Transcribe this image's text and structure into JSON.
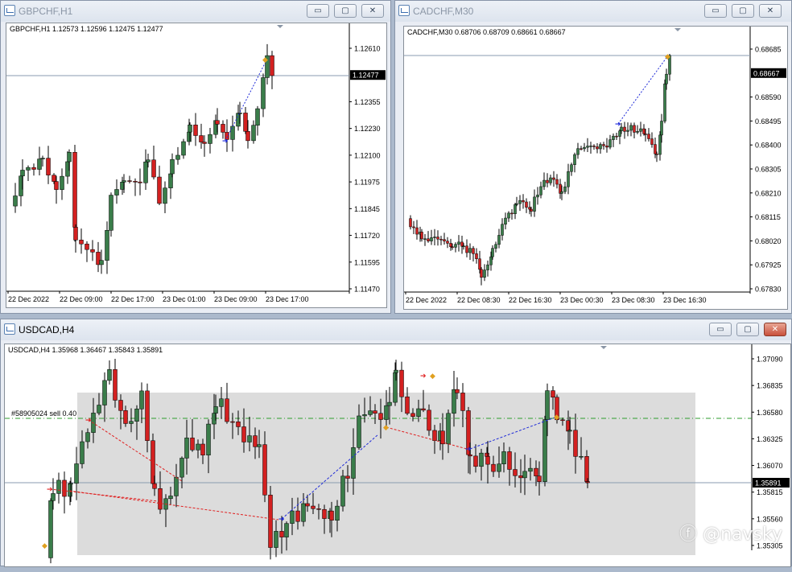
{
  "windows": [
    {
      "id": "gbp",
      "title": "GBPCHF,H1",
      "info": "GBPCHF,H1  1.12573 1.12596 1.12475 1.12477",
      "price_labels": [
        "1.12610",
        "1.12477",
        "1.12355",
        "1.12230",
        "1.12100",
        "1.11975",
        "1.11845",
        "1.11720",
        "1.11595",
        "1.11470"
      ],
      "current_price": "1.12477",
      "time_labels": [
        "22 Dec 2022",
        "22 Dec 09:00",
        "22 Dec 17:00",
        "23 Dec 01:00",
        "23 Dec 09:00",
        "23 Dec 17:00"
      ]
    },
    {
      "id": "cad",
      "title": "CADCHF,M30",
      "info": "CADCHF,M30  0.68706 0.68709 0.68661 0.68667",
      "price_labels": [
        "0.68685",
        "0.68667",
        "0.68590",
        "0.68495",
        "0.68400",
        "0.68305",
        "0.68210",
        "0.68115",
        "0.68020",
        "0.67925",
        "0.67830"
      ],
      "current_price": "0.68667",
      "time_labels": [
        "22 Dec 2022",
        "22 Dec 08:30",
        "22 Dec 16:30",
        "23 Dec 00:30",
        "23 Dec 08:30",
        "23 Dec 16:30"
      ]
    },
    {
      "id": "usd",
      "title": "USDCAD,H4",
      "info": "USDCAD,H4  1.35968 1.36467 1.35843 1.35891",
      "price_labels": [
        "1.37090",
        "1.36835",
        "1.36580",
        "1.36325",
        "1.36070",
        "1.35891",
        "1.35815",
        "1.35560",
        "1.35305"
      ],
      "current_price": "1.35891",
      "order_label": "#58905024 sell 0.40"
    }
  ],
  "window_buttons": {
    "minimize": "▭",
    "maximize": "▢",
    "close": "✕"
  },
  "watermark": "ⓕ @navsky",
  "colors": {
    "bull": "#3a7d4a",
    "bear": "#d32020",
    "wick": "#000000",
    "price_line": "#8a9bb0",
    "order_line": "#2e9e2e",
    "zone": "#dcdcdc"
  }
}
